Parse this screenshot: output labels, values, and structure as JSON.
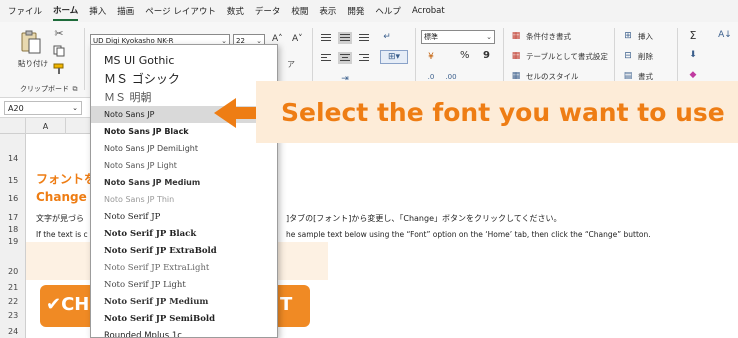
{
  "menu": [
    "ファイル",
    "ホーム",
    "挿入",
    "描画",
    "ページ レイアウト",
    "数式",
    "データ",
    "校閲",
    "表示",
    "開発",
    "ヘルプ",
    "Acrobat"
  ],
  "menu_active_index": 1,
  "ribbon": {
    "paste_label": "貼り付け",
    "clipboard_label": "クリップボード",
    "font_name": "UD Digi Kyokasho NK-R",
    "font_size": "22",
    "grow_font": "A˄",
    "shrink_font": "A˅",
    "number_format": "標準",
    "cond_format": "条件付き書式",
    "format_table": "テーブルとして書式設定",
    "cell_styles": "セルのスタイル",
    "insert": "挿入",
    "delete": "削除",
    "format": "書式",
    "percent": "%",
    "comma": "9"
  },
  "formula_bar": {
    "name_box": "A20"
  },
  "columns": [
    "A"
  ],
  "rows": [
    "14",
    "15",
    "16",
    "17",
    "18",
    "19",
    "20",
    "21",
    "22",
    "23",
    "24"
  ],
  "sheet": {
    "row15_text": "フォントを",
    "row16_text": "Change f",
    "row18_left": "文字が見づら",
    "row18_right": "]タブの[フォント]から変更し、「Change」ボタンをクリックしてください。",
    "row19_left": "If the text is c",
    "row19_right": "he sample text below using the “Font” option on the ‘Home’ tab, then click the “Change” button.",
    "button_left": "✔CH",
    "button_right": "T"
  },
  "font_dropdown": {
    "selected_index": 3,
    "items": [
      "MS UI Gothic",
      "ＭＳ ゴシック",
      "ＭＳ 明朝",
      "Noto Sans JP",
      "Noto Sans JP Black",
      "Noto Sans JP DemiLight",
      "Noto Sans JP Light",
      "Noto Sans JP Medium",
      "Noto Sans JP Thin",
      "Noto Serif JP",
      "Noto Serif JP Black",
      "Noto Serif JP ExtraBold",
      "Noto Serif JP ExtraLight",
      "Noto Serif JP Light",
      "Noto Serif JP Medium",
      "Noto Serif JP SemiBold",
      "Rounded Mplus 1c"
    ]
  },
  "callout": {
    "text": "Select the font you want to use"
  },
  "colors": {
    "accent_orange": "#ee7d14",
    "callout_bg": "#fdecd8",
    "button_orange": "#f08a24",
    "excel_green": "#1e6b3a"
  }
}
